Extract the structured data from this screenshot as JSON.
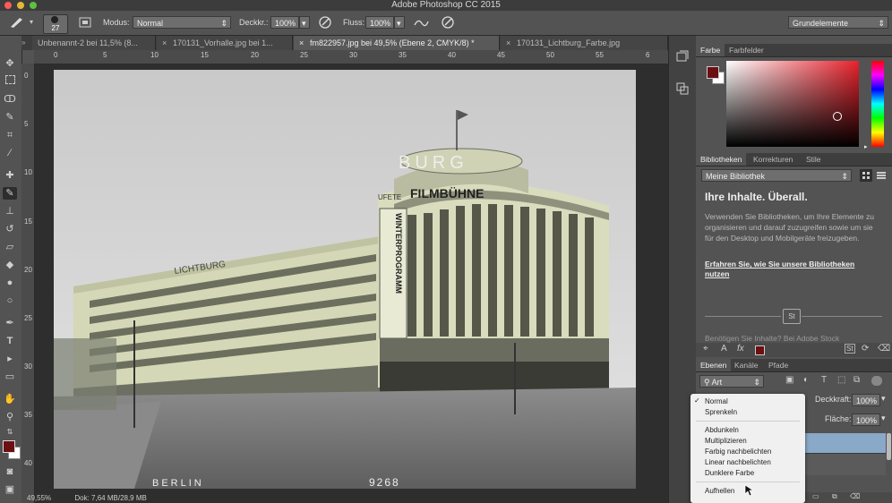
{
  "app": {
    "title": "Adobe Photoshop CC 2015"
  },
  "options_bar": {
    "brush_size": "27",
    "mode_label": "Modus:",
    "mode_value": "Normal",
    "opacity_label": "Deckkr.:",
    "opacity_value": "100%",
    "flow_label": "Fluss:",
    "flow_value": "100%",
    "workspace_value": "Grundelemente"
  },
  "doc_tabs": [
    {
      "label": "Unbenannt-2 bei 11,5% (8..."
    },
    {
      "label": "170131_Vorhalle.jpg bei 1..."
    },
    {
      "label": "fm822957.jpg bei 49,5% (Ebene 2, CMYK/8) *"
    },
    {
      "label": "170131_Lichtburg_Farbe.jpg"
    }
  ],
  "ruler": {
    "top": [
      "0",
      "5",
      "10",
      "15",
      "20",
      "25",
      "30",
      "35",
      "40",
      "45",
      "50",
      "55",
      "6"
    ],
    "left": [
      "0",
      "5",
      "10",
      "15",
      "20",
      "25",
      "30",
      "35",
      "40"
    ]
  },
  "photo_text": {
    "sign_top": "BURG",
    "sign_band": "FILMBÜHNE",
    "sign_band_left": "UFETE",
    "sign_vertical": "WINTERPROGRAMM",
    "sign_left": "LICHTBURG",
    "caption_left": "BERLIN",
    "caption_right": "9268"
  },
  "status_bar": {
    "zoom": "49,55%",
    "doc": "Dok: 7,64 MB/28,9 MB"
  },
  "color_panel": {
    "tabs": [
      "Farbe",
      "Farbfelder"
    ],
    "foreground": "#6b0f12",
    "background": "#ffffff"
  },
  "libraries_panel": {
    "tabs": [
      "Bibliotheken",
      "Korrekturen",
      "Stile"
    ],
    "library_select": "Meine Bibliothek",
    "heading": "Ihre Inhalte. Überall.",
    "body": "Verwenden Sie Bibliotheken, um Ihre Elemente zu organisieren und darauf zuzugreifen sowie um sie für den Desktop und Mobilgeräte freizugeben.",
    "link": "Erfahren Sie, wie Sie unsere Bibliotheken nutzen",
    "stock_text": "Benötigen Sie Inhalte?  Bei Adobe Stock",
    "stock_badge": "St"
  },
  "layers_panel": {
    "tabs": [
      "Ebenen",
      "Kanäle",
      "Pfade"
    ],
    "filter_value": "Art",
    "opacity_label": "Deckkraft:",
    "opacity_value": "100%",
    "fill_label": "Fläche:",
    "fill_value": "100%"
  },
  "blend_menu": {
    "items": [
      "Normal",
      "Sprenkeln",
      "Abdunkeln",
      "Multiplizieren",
      "Farbig nachbelichten",
      "Linear nachbelichten",
      "Dunklere Farbe",
      "Aufhellen"
    ],
    "checkmark": "✓"
  },
  "colors": {
    "accent_blue": "#8aa8c8"
  }
}
